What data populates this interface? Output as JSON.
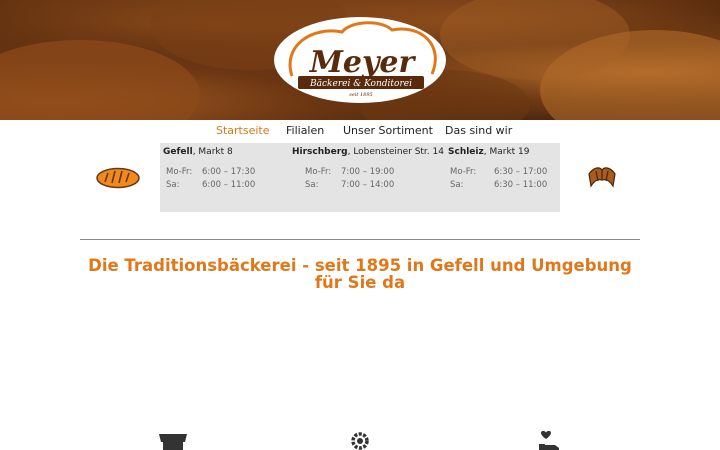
{
  "logo": {
    "name": "Meyer",
    "subtitle": "Bäckerei & Konditorei",
    "since": "seit 1895"
  },
  "nav": [
    {
      "label": "Startseite",
      "active": true
    },
    {
      "label": "Filialen",
      "active": false
    },
    {
      "label": "Unser Sortiment",
      "active": false
    },
    {
      "label": "Das sind wir",
      "active": false
    }
  ],
  "branches": [
    {
      "town": "Gefell",
      "address": ", Markt 8",
      "rows": [
        {
          "days": "Mo-Fr:",
          "time": "6:00 – 17:30"
        },
        {
          "days": "Sa:",
          "time": "6:00 – 11:00"
        }
      ]
    },
    {
      "town": "Hirschberg",
      "address": ", Lobensteiner Str. 14",
      "rows": [
        {
          "days": "Mo-Fr:",
          "time": "7:00 – 19:00"
        },
        {
          "days": "Sa:",
          "time": "7:00 – 14:00"
        }
      ]
    },
    {
      "town": "Schleiz",
      "address": ", Markt 19",
      "rows": [
        {
          "days": "Mo-Fr:",
          "time": "6:30 – 17:00"
        },
        {
          "days": "Sa:",
          "time": "6:30 – 11:00"
        }
      ]
    }
  ],
  "headline": "Die Traditionsbäckerei - seit 1895 in Gefell und Umgebung für Sie da",
  "icons": {
    "left": "bread-loaf-icon",
    "right": "croissant-icon",
    "features": [
      "store-icon",
      "gear-icon",
      "heart-hand-icon"
    ]
  },
  "colors": {
    "accent": "#e0781a",
    "logo_brown": "#5a2a0c",
    "hours_bg": "#e4e4e4"
  }
}
